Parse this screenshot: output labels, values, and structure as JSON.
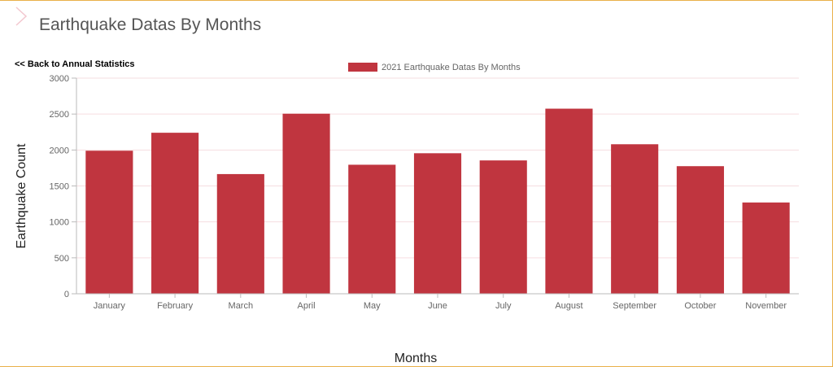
{
  "header": {
    "title": "Earthquake Datas By Months"
  },
  "nav": {
    "back_label": "<< Back to Annual Statistics"
  },
  "colors": {
    "bar": "#c0353f",
    "grid": "#f6dde0",
    "axis": "#bbbbbb",
    "chevron": "#f3c7cf"
  },
  "chart_data": {
    "type": "bar",
    "categories": [
      "January",
      "February",
      "March",
      "April",
      "May",
      "June",
      "July",
      "August",
      "September",
      "October",
      "November"
    ],
    "series": [
      {
        "name": "2021 Earthquake Datas By Months",
        "values": [
          1990,
          2240,
          1665,
          2505,
          1795,
          1955,
          1855,
          2575,
          2080,
          1775,
          1270
        ]
      }
    ],
    "xlabel": "Months",
    "ylabel": "Earthquake Count",
    "ylim": [
      0,
      3000
    ],
    "yticks": [
      "0",
      "500",
      "1000",
      "1500",
      "2000",
      "2500",
      "3000"
    ],
    "grid": true,
    "legend_position": "top"
  }
}
